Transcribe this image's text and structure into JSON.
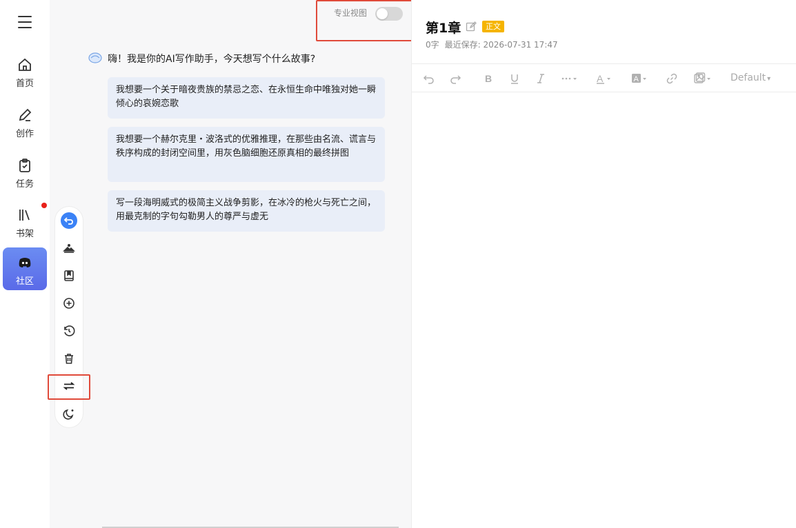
{
  "nav": {
    "items": [
      {
        "label": "首页",
        "icon": "home-icon"
      },
      {
        "label": "创作",
        "icon": "pen-icon"
      },
      {
        "label": "任务",
        "icon": "clipboard-check-icon"
      },
      {
        "label": "书架",
        "icon": "bookshelf-icon"
      },
      {
        "label": "社区",
        "icon": "discord-icon"
      }
    ]
  },
  "chat": {
    "pro_view_label": "专业视图",
    "pro_view_enabled": false,
    "greeting": "嗨！我是你的AI写作助手，今天想写个什么故事?",
    "prompts": [
      "我想要一个关于暗夜贵族的禁忌之恋、在永恒生命中唯独对她一瞬倾心的哀婉恋歌",
      "我想要一个赫尔克里・波洛式的优雅推理，在那些由名流、谎言与秩序构成的封闭空间里，用灰色脑细胞还原真相的最终拼图",
      "写一段海明威式的极简主义战争剪影，在冰冷的枪火与死亡之间，用最克制的字句勾勒男人的尊严与虚无"
    ],
    "tools": [
      "back-icon",
      "landscape-icon",
      "bookmark-icon",
      "add-circle-icon",
      "history-icon",
      "trash-icon",
      "swap-icon",
      "moon-icon"
    ]
  },
  "editor": {
    "title": "第1章",
    "badge": "正文",
    "word_count": "0字",
    "last_saved": "最近保存: 2026-07-31 17:47",
    "font_select": "Default",
    "font_select_caret": "▾"
  },
  "colors": {
    "accent": "#3b82f6",
    "badge": "#f5b400",
    "highlight": "#e04a3a",
    "active_nav": "#5a6ae8"
  }
}
